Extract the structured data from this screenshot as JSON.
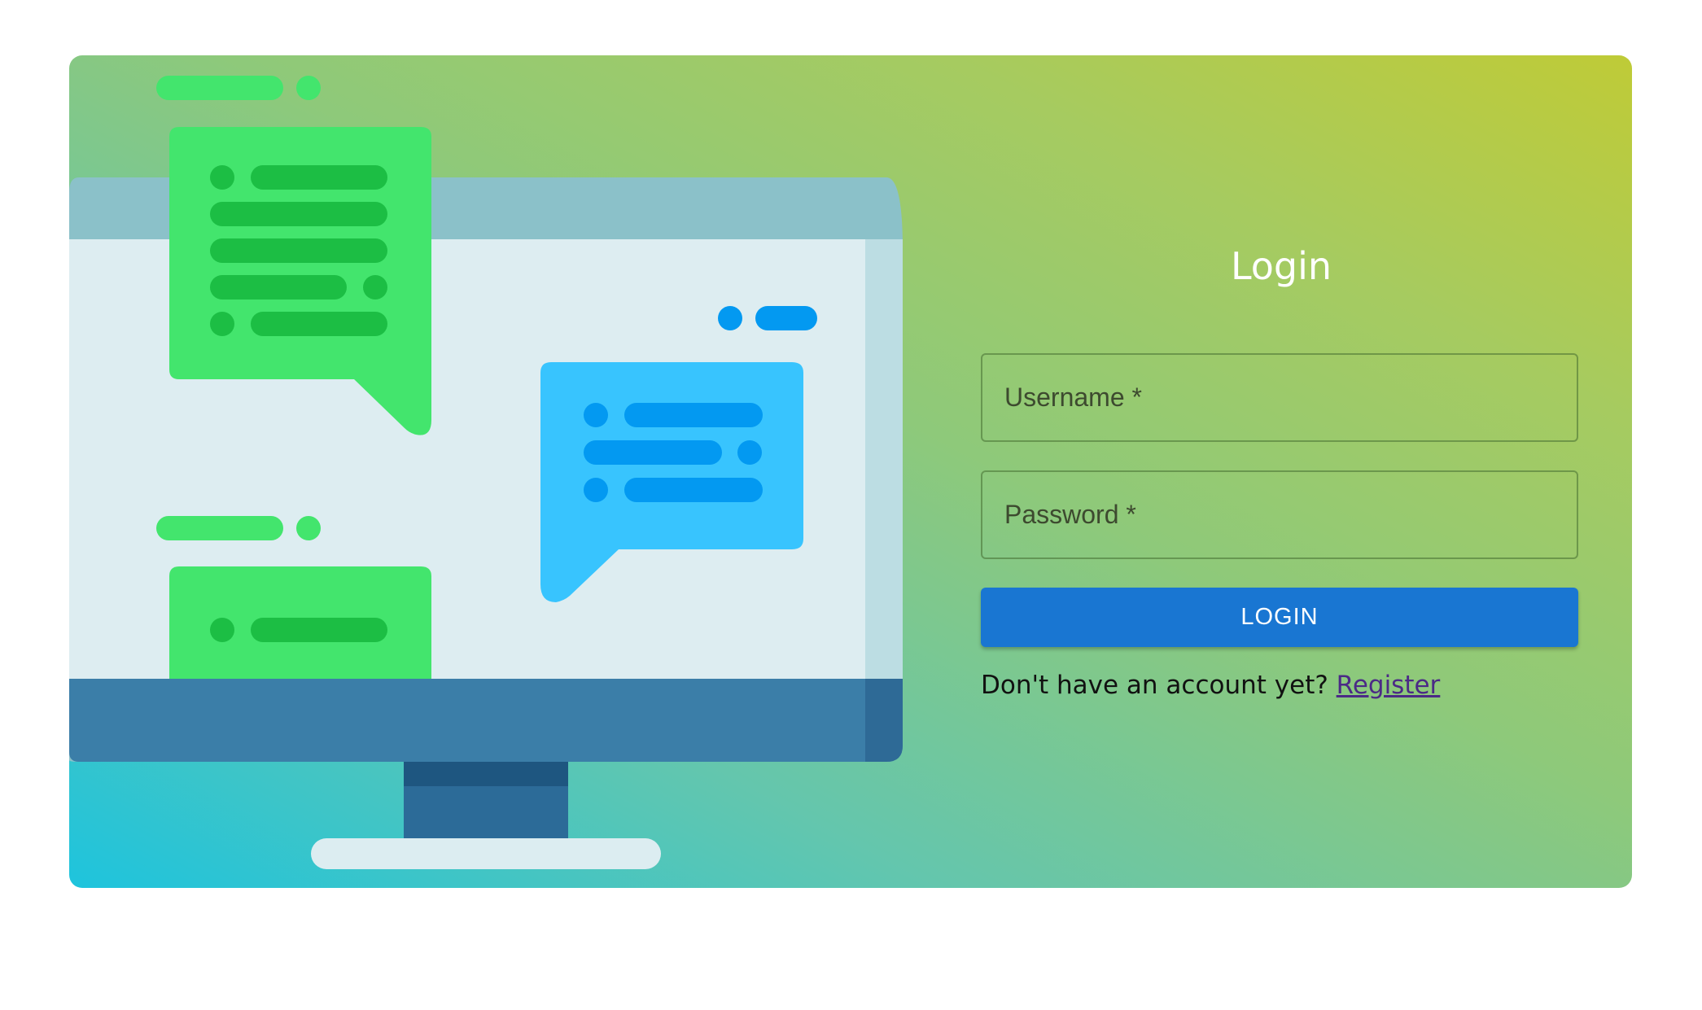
{
  "login_form": {
    "title": "Login",
    "username": {
      "label": "Username *",
      "value": ""
    },
    "password": {
      "label": "Password *",
      "value": ""
    },
    "submit_label": "LOGIN",
    "register_prompt": "Don't have an account yet?",
    "register_link_label": "Register"
  },
  "colors": {
    "gradient_start": "#1ec4dd",
    "gradient_end": "#bfcb37",
    "button": "#1976d2",
    "chat_green": "#43e56d",
    "chat_blue": "#38c4fe",
    "monitor_bezel": "#3b7ea8"
  },
  "illustration": {
    "icon": "desktop-chat-illustration"
  }
}
